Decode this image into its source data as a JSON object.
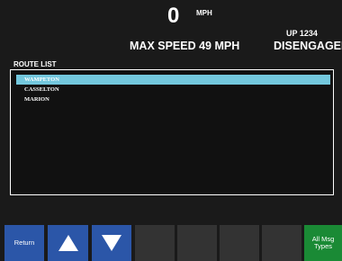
{
  "header": {
    "speed_value": "0",
    "speed_unit": "MPH",
    "max_speed": "MAX SPEED 49 MPH",
    "train_id": "UP 1234",
    "engage_status": "DISENGAGED"
  },
  "route_list": {
    "title": "ROUTE LIST",
    "routes": [
      "WAMPETON",
      "CASSELTON",
      "MARION"
    ],
    "selected": "WAMPETON"
  },
  "buttons": {
    "return_label": "Return",
    "all_msg_types_line1": "All Msg",
    "all_msg_types_line2": "Types"
  },
  "colors": {
    "selected_row": "#73c7dd",
    "button_blue": "#2b56a8",
    "button_green": "#1a8a35"
  },
  "icons": {
    "scroll_up": "triangle-up",
    "scroll_down": "triangle-down"
  }
}
